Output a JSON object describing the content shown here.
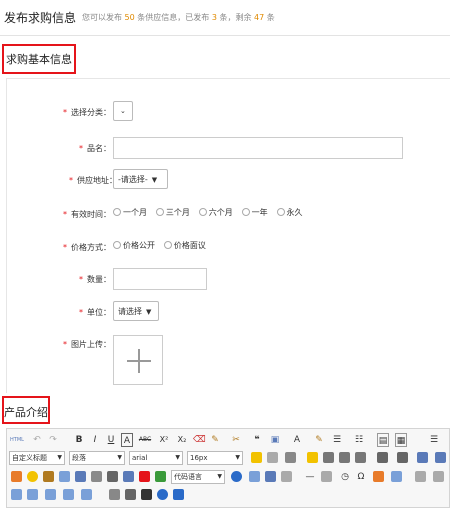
{
  "header": {
    "title": "发布求购信息",
    "quota_prefix": "您可以发布",
    "quota_total": "50",
    "quota_mid": "条供应信息，已发布",
    "quota_used": "3",
    "quota_mid2": "条，剩余",
    "quota_left": "47",
    "quota_suffix": "条"
  },
  "sections": {
    "basic_info": "求购基本信息",
    "product_intro": "产品介绍"
  },
  "form": {
    "category": {
      "label": "选择分类："
    },
    "name": {
      "label": "品名：",
      "value": ""
    },
    "supply_address": {
      "label": "供应地址：",
      "value": "-请选择-"
    },
    "validity": {
      "label": "有效时间：",
      "options": [
        "一个月",
        "三个月",
        "六个月",
        "一年",
        "永久"
      ]
    },
    "price_method": {
      "label": "价格方式：",
      "options": [
        "价格公开",
        "价格面议"
      ]
    },
    "quantity": {
      "label": "数量：",
      "value": ""
    },
    "unit": {
      "label": "单位：",
      "value": "请选择"
    },
    "image_upload": {
      "label": "图片上传："
    }
  },
  "editor": {
    "row1": [
      "HTML",
      "↶",
      "↷",
      "B",
      "I",
      "U",
      "A",
      "ABC",
      "X²",
      "X₂",
      "⌫",
      "✎",
      "✂",
      "❝",
      "▣",
      "A",
      "✎",
      "☰",
      "☷",
      "▤",
      "▦",
      "☰"
    ],
    "style_select": "自定义标题",
    "para_select": "段落",
    "font_select": "arial",
    "size_select": "16px",
    "code_select": "代码语言"
  },
  "colors": {
    "accent": "#e5141a",
    "number": "#e08a00"
  }
}
